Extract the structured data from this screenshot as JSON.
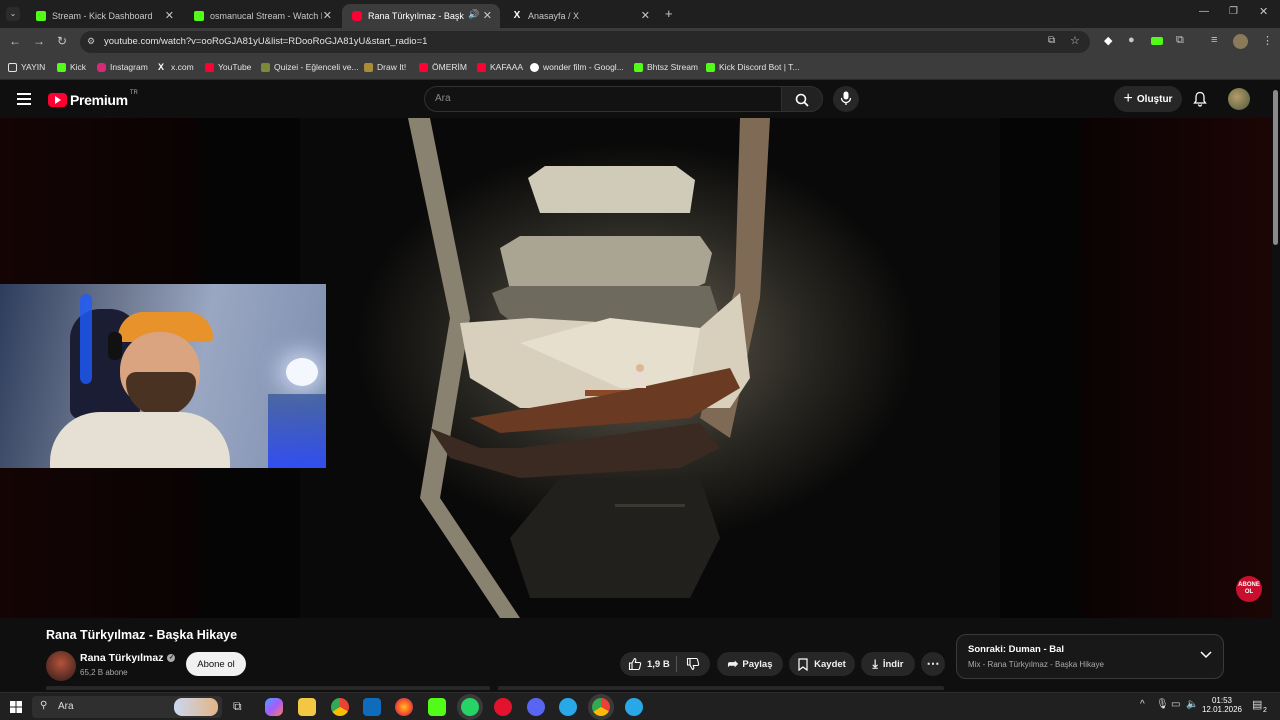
{
  "browser": {
    "tabs": [
      {
        "title": "Stream - Kick Dashboard",
        "favicon": "kick-icon",
        "active": false
      },
      {
        "title": "osmanucal Stream - Watch Live",
        "favicon": "kick-icon",
        "active": false
      },
      {
        "title": "Rana Türkyılmaz - Başka Hi",
        "favicon": "youtube-icon",
        "active": true
      },
      {
        "title": "Anasayfa / X",
        "favicon": "x-icon",
        "active": false
      }
    ],
    "url": "youtube.com/watch?v=ooRoGJA81yU&list=RDooRoGJA81yU&start_radio=1",
    "bookmarks": [
      {
        "label": "YAYIN",
        "icon": "folder-icon"
      },
      {
        "label": "Kick",
        "icon": "kick-icon"
      },
      {
        "label": "Instagram",
        "icon": "instagram-icon"
      },
      {
        "label": "x.com",
        "icon": "x-icon"
      },
      {
        "label": "YouTube",
        "icon": "youtube-icon"
      },
      {
        "label": "Quizei - Eğlenceli ve...",
        "icon": "quizei-icon"
      },
      {
        "label": "Draw It!",
        "icon": "drawit-icon"
      },
      {
        "label": "ÖMERİM",
        "icon": "youtube-icon"
      },
      {
        "label": "KAFAAA",
        "icon": "youtube-icon"
      },
      {
        "label": "wonder film - Googl...",
        "icon": "google-icon"
      },
      {
        "label": "Bhtsz Stream",
        "icon": "kick-icon"
      },
      {
        "label": "Kick Discord Bot | T...",
        "icon": "kick-icon"
      }
    ]
  },
  "youtube": {
    "logo_text": "Premium",
    "logo_region": "TR",
    "search_placeholder": "Ara",
    "create_label": "Oluştur",
    "video_title": "Rana Türkyılmaz - Başka Hikaye",
    "channel_name": "Rana Türkyılmaz",
    "subscribers": "65,2 B abone",
    "subscribe_label": "Abone ol",
    "likes": "1,9 B",
    "share_label": "Paylaş",
    "save_label": "Kaydet",
    "download_label": "İndir",
    "next_title": "Sonraki: Duman - Bal",
    "next_sub": "Mix - Rana Türkyılmaz - Başka Hikaye",
    "overlay_badge": "ABONE OL"
  },
  "taskbar": {
    "search_label": "Ara",
    "time": "01:53",
    "date": "12.01.2026",
    "notification_count": "2"
  },
  "colors": {
    "youtube_red": "#ff0033",
    "kick_green": "#53fc18"
  }
}
